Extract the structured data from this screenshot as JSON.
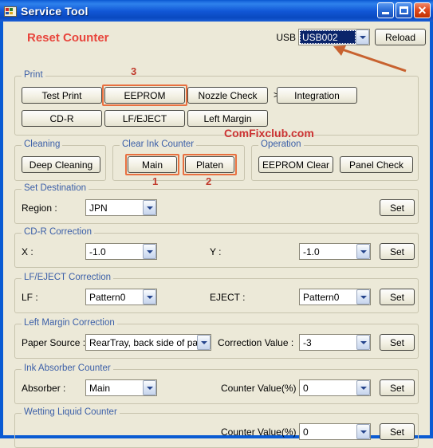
{
  "window": {
    "title": "Service Tool",
    "icon": "printer-app-icon",
    "minimize_label": "",
    "maximize_label": "",
    "close_label": "✕"
  },
  "header": {
    "heading": "Reset Counter",
    "heading_color": "#E8453C",
    "usb_port_label": "USB Port :",
    "usb_port_value": "USB002",
    "reload_label": "Reload"
  },
  "watermark": "ComFixclub.com",
  "markers": {
    "one": "1",
    "two": "2",
    "three": "3"
  },
  "groups": {
    "print": {
      "legend": "Print",
      "buttons": [
        "Test Print",
        "EEPROM",
        "Nozzle Check",
        "Integration",
        "CD-R",
        "LF/EJECT",
        "Left Margin"
      ],
      "separator": ">>"
    },
    "cleaning": {
      "legend": "Cleaning",
      "buttons": [
        "Deep Cleaning"
      ]
    },
    "clear_ink_counter": {
      "legend": "Clear Ink Counter",
      "buttons": [
        "Main",
        "Platen"
      ]
    },
    "operation": {
      "legend": "Operation",
      "buttons": [
        "EEPROM Clear",
        "Panel Check"
      ]
    },
    "set_destination": {
      "legend": "Set Destination",
      "region_label": "Region :",
      "region_value": "JPN",
      "set_label": "Set"
    },
    "cdr_correction": {
      "legend": "CD-R Correction",
      "x_label": "X :",
      "x_value": "-1.0",
      "y_label": "Y :",
      "y_value": "-1.0",
      "set_label": "Set"
    },
    "lfeject_correction": {
      "legend": "LF/EJECT Correction",
      "lf_label": "LF :",
      "lf_value": "Pattern0",
      "eject_label": "EJECT :",
      "eject_value": "Pattern0",
      "set_label": "Set"
    },
    "left_margin_correction": {
      "legend": "Left Margin Correction",
      "paper_source_label": "Paper Source :",
      "paper_source_value": "RearTray, back side of paper",
      "correction_value_label": "Correction Value :",
      "correction_value": "-3",
      "set_label": "Set"
    },
    "ink_absorber_counter": {
      "legend": "Ink Absorber Counter",
      "absorber_label": "Absorber :",
      "absorber_value": "Main",
      "counter_label": "Counter Value(%) :",
      "counter_value": "0",
      "set_label": "Set"
    },
    "wetting_liquid_counter": {
      "legend": "Wetting Liquid Counter",
      "counter_label": "Counter Value(%) :",
      "counter_value": "0",
      "set_label": "Set"
    }
  },
  "colors": {
    "accent_highlight": "#E87040",
    "legend_text": "#3B5FA8",
    "title_red": "#E8453C",
    "titlebar_blue": "#0A57D0",
    "client_bg": "#ECE9D8"
  }
}
